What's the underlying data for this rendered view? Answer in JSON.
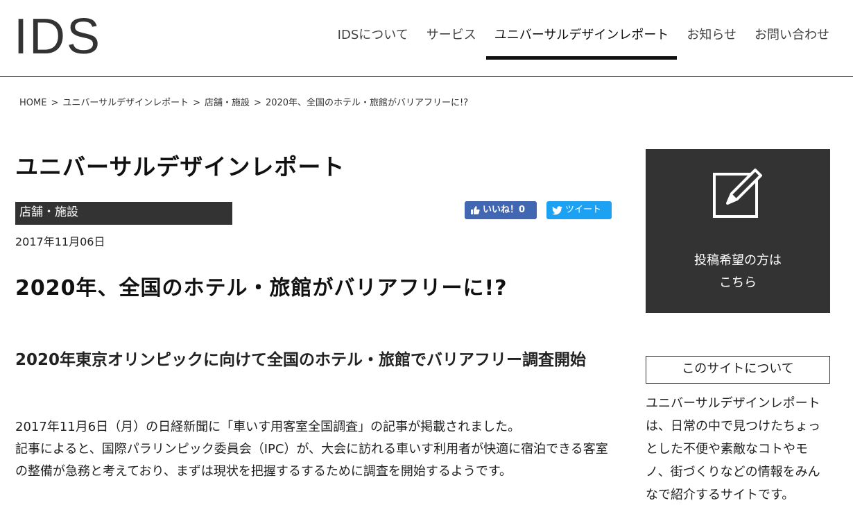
{
  "header": {
    "logo": "IDS",
    "nav": [
      {
        "label": "IDSについて"
      },
      {
        "label": "サービス"
      },
      {
        "label": "ユニバーサルデザインレポート"
      },
      {
        "label": "お知らせ"
      },
      {
        "label": "お問い合わせ"
      }
    ],
    "active_nav": "ユニバーサルデザインレポート"
  },
  "breadcrumb": {
    "items": [
      "HOME",
      "ユニバーサルデザインレポート",
      "店舗・施設",
      "2020年、全国のホテル・旅館がバリアフリーに!?"
    ],
    "separator": ">"
  },
  "section_title": "ユニバーサルデザインレポート",
  "category": "店舗・施設",
  "share": {
    "facebook_label": "いいね！0",
    "twitter_label": "ツイート",
    "facebook_color": "#4267b2",
    "twitter_color": "#1da1f2"
  },
  "date": "2017年11月06日",
  "article_title": "2020年、全国のホテル・旅館がバリアフリーに!?",
  "subhead": "2020年東京オリンピックに向けて全国のホテル・旅館でバリアフリー調査開始",
  "body": {
    "line1": "2017年11月6日（月）の日経新聞に「車いす用客室全国調査」の記事が掲載されました。",
    "line2": "記事によると、国際パラリンピック委員会（IPC）が、大会に訪れる車いす利用者が快適に宿泊できる客室の整備が急務と考えており、まずは現状を把握するするために調査を開始するようです。"
  },
  "sidebar": {
    "post_box": {
      "icon": "edit-icon",
      "line1": "投稿希望の方は",
      "line2": "こちら"
    },
    "about_title": "このサイトについて",
    "about_text": "ユニバーサルデザインレポートは、日常の中で見つけたちょっとした不便や素敵なコトやモノ、街づくりなどの情報をみんなで紹介するサイトです。"
  }
}
